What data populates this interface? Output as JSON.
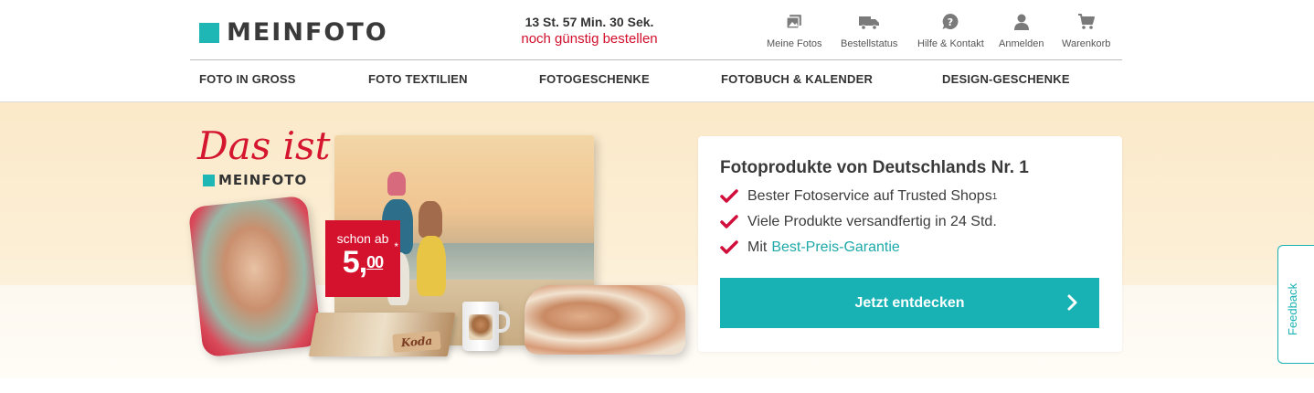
{
  "logo": {
    "text": "MEINFOTO"
  },
  "countdown": {
    "time": "13 St. 57 Min. 30 Sek.",
    "cta": "noch günstig bestellen"
  },
  "utility_nav": [
    {
      "label": "Meine Fotos",
      "icon": "photos-icon"
    },
    {
      "label": "Bestellstatus",
      "icon": "delivery-truck-icon"
    },
    {
      "label": "Hilfe & Kontakt",
      "icon": "help-icon"
    },
    {
      "label": "Anmelden",
      "icon": "user-icon"
    },
    {
      "label": "Warenkorb",
      "icon": "cart-icon"
    }
  ],
  "main_nav": [
    {
      "label": "FOTO IN GROSS"
    },
    {
      "label": "FOTO TEXTILIEN"
    },
    {
      "label": "FOTOGESCHENKE"
    },
    {
      "label": "FOTOBUCH & KALENDER"
    },
    {
      "label": "DESIGN-GESCHENKE"
    }
  ],
  "hero": {
    "script_text": "Das ist",
    "brand_text": "MEINFOTO",
    "price_prefix": "schon ab",
    "price_main": "5,",
    "price_cents": "00",
    "price_footnote": "*",
    "photobook_name": "Koda",
    "card": {
      "title": "Fotoprodukte von Deutschlands Nr. 1",
      "bullets": [
        {
          "text": "Bester Fotoservice auf Trusted Shops",
          "sup": "1"
        },
        {
          "text": "Viele Produkte versandfertig in 24 Std."
        },
        {
          "text": "Mit",
          "link": "Best-Preis-Garantie"
        }
      ],
      "cta_label": "Jetzt entdecken"
    }
  },
  "feedback": {
    "label": "Feedback"
  },
  "colors": {
    "accent": "#19b2b4",
    "brand_red": "#d4122e",
    "check_red": "#d20f3c"
  }
}
